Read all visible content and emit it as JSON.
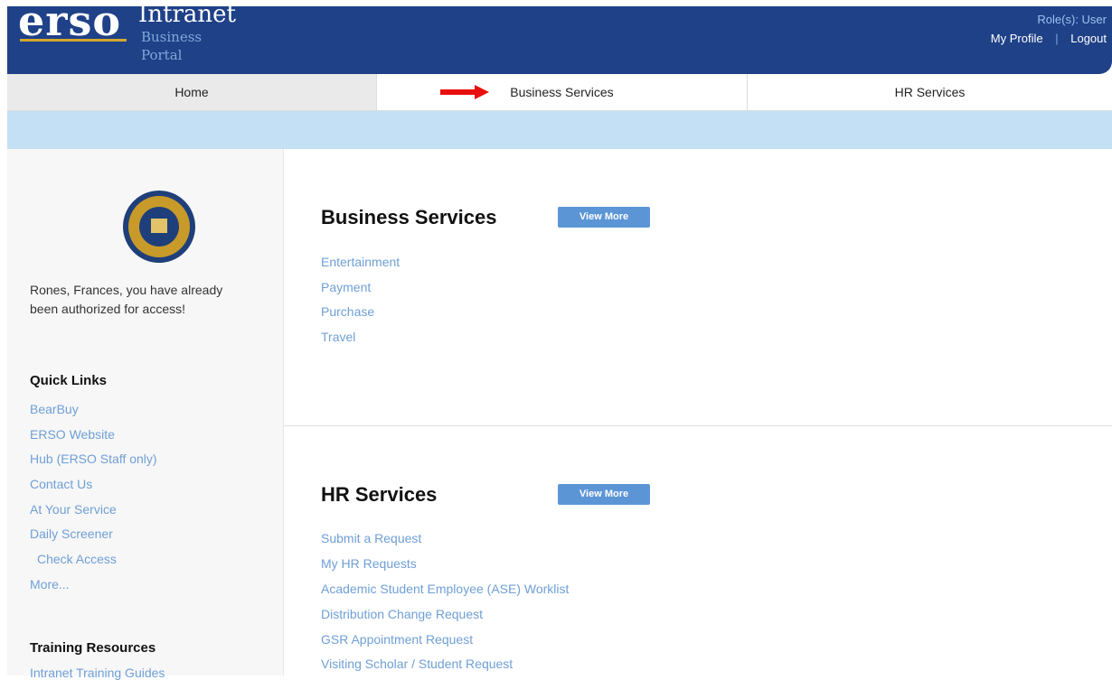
{
  "header": {
    "logo_main": "erso",
    "logo_title": "Intranet",
    "logo_subtitle": "Business Portal",
    "role": "Role(s): User",
    "my_profile": "My Profile",
    "separator": "|",
    "logout": "Logout",
    "bg_color": "#1f4188"
  },
  "tabs": [
    {
      "label": "Home"
    },
    {
      "label": "Business Services"
    },
    {
      "label": "HR Services"
    }
  ],
  "sidebar": {
    "auth_message": "Rones, Frances, you have already been authorized for access!",
    "quick_links_title": "Quick Links",
    "quick_links": [
      "BearBuy",
      "ERSO Website",
      "Hub (ERSO Staff only)",
      "Contact Us",
      "At Your Service",
      "Daily Screener",
      "Check Access",
      "More..."
    ],
    "training_title": "Training Resources",
    "training_items": [
      "Intranet Training Guides"
    ]
  },
  "business": {
    "title": "Business Services",
    "view_more": "View More",
    "links": [
      "Entertainment",
      "Payment",
      "Purchase",
      "Travel"
    ]
  },
  "hr": {
    "title": "HR Services",
    "view_more": "View More",
    "links": [
      "Submit a Request",
      "My HR Requests",
      "Academic Student Employee (ASE) Worklist",
      "Distribution Change Request",
      "GSR Appointment Request",
      "Visiting Scholar / Student Request"
    ]
  },
  "colors": {
    "link": "#6f9fd6",
    "banner": "#c4e0f5",
    "button": "#5b95d6",
    "arrow": "#e8100e"
  }
}
